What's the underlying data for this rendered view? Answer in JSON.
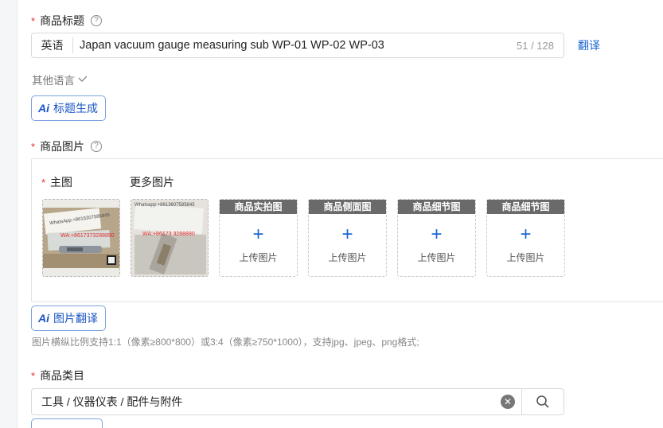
{
  "title_section": {
    "required_mark": "*",
    "label": "商品标题",
    "help": "?",
    "lang": "英语",
    "value": "Japan  vacuum gauge measuring sub WP-01 WP-02 WP-03",
    "count": "51 / 128",
    "translate_link": "翻译",
    "other_lang_label": "其他语言",
    "other_lang_icon": "chevron-down-icon",
    "ai_mark": "Ai",
    "ai_button": "标题生成"
  },
  "image_section": {
    "required_mark": "*",
    "label": "商品图片",
    "help": "?",
    "main_label": "主图",
    "more_label": "更多图片",
    "main_image": {
      "caption_top": "WhatsApp:+8615307585845",
      "caption_red": "WA:+8617373288890"
    },
    "more_image": {
      "caption_top": "Whatsapp:+8613607585845",
      "caption_red": "WA:+86173 3288890"
    },
    "slots": [
      {
        "title": "商品实拍图",
        "plus": "+",
        "text": "上传图片"
      },
      {
        "title": "商品侧面图",
        "plus": "+",
        "text": "上传图片"
      },
      {
        "title": "商品细节图",
        "plus": "+",
        "text": "上传图片"
      },
      {
        "title": "商品细节图",
        "plus": "+",
        "text": "上传图片"
      }
    ],
    "ai_mark": "Ai",
    "ai_button": "图片翻译",
    "hint": "图片横纵比例支持1:1（像素≥800*800）或3:4（像素≥750*1000），支持jpg、jpeg、png格式;"
  },
  "category_section": {
    "required_mark": "*",
    "label": "商品类目",
    "value": "工具 / 仪器仪表 / 配件与附件",
    "clear_icon": "close-circle-icon",
    "search_icon": "search-icon"
  },
  "colors": {
    "accent": "#1a66d2",
    "required": "#e62e2e",
    "slot_header": "#6a6a6a"
  }
}
